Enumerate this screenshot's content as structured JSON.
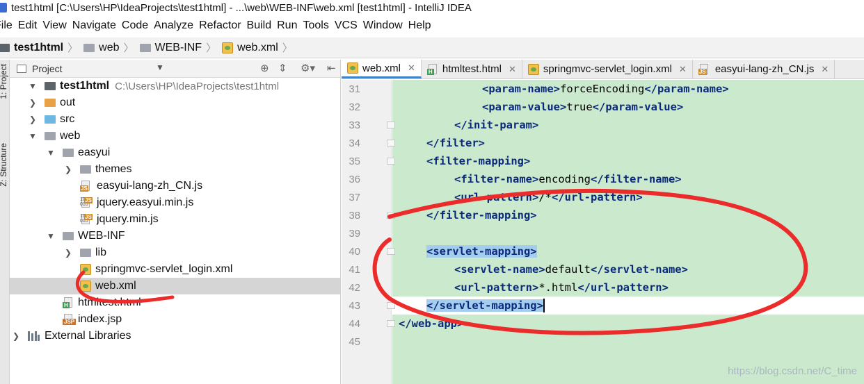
{
  "window": {
    "title": "test1html [C:\\Users\\HP\\IdeaProjects\\test1html] - ...\\web\\WEB-INF\\web.xml [test1html] - IntelliJ IDEA"
  },
  "menu": [
    "File",
    "Edit",
    "View",
    "Navigate",
    "Code",
    "Analyze",
    "Refactor",
    "Build",
    "Run",
    "Tools",
    "VCS",
    "Window",
    "Help"
  ],
  "breadcrumb": [
    "test1html",
    "web",
    "WEB-INF",
    "web.xml"
  ],
  "sidetabs": {
    "project": "1: Project",
    "structure": "Z: Structure"
  },
  "project_panel": {
    "title": "Project",
    "root": {
      "name": "test1html",
      "path": "C:\\Users\\HP\\IdeaProjects\\test1html"
    },
    "items": [
      {
        "label": "out"
      },
      {
        "label": "src"
      },
      {
        "label": "web"
      },
      {
        "label": "easyui"
      },
      {
        "label": "themes"
      },
      {
        "label": "easyui-lang-zh_CN.js"
      },
      {
        "label": "jquery.easyui.min.js"
      },
      {
        "label": "jquery.min.js"
      },
      {
        "label": "WEB-INF"
      },
      {
        "label": "lib"
      },
      {
        "label": "springmvc-servlet_login.xml"
      },
      {
        "label": "web.xml"
      },
      {
        "label": "htmltest.html"
      },
      {
        "label": "index.jsp"
      },
      {
        "label": "External Libraries"
      }
    ]
  },
  "editor_tabs": [
    {
      "label": "web.xml",
      "active": true
    },
    {
      "label": "htmltest.html"
    },
    {
      "label": "springmvc-servlet_login.xml"
    },
    {
      "label": "easyui-lang-zh_CN.js"
    }
  ],
  "code_lines": [
    {
      "num": "31",
      "open": "<param-name>",
      "text": "forceEncoding",
      "close": "</param-name>"
    },
    {
      "num": "32",
      "open": "<param-value>",
      "text": "true",
      "close": "</param-value>"
    },
    {
      "num": "33",
      "open": "</init-param>"
    },
    {
      "num": "34",
      "open": "</filter>"
    },
    {
      "num": "35",
      "open": "<filter-mapping>"
    },
    {
      "num": "36",
      "open": "<filter-name>",
      "text": "encoding",
      "close": "</filter-name>"
    },
    {
      "num": "37",
      "open": "<url-pattern>",
      "text": "/*",
      "close": "</url-pattern>"
    },
    {
      "num": "38",
      "open": "</filter-mapping>"
    },
    {
      "num": "39"
    },
    {
      "num": "40",
      "open": "<servlet-mapping>"
    },
    {
      "num": "41",
      "open": "<servlet-name>",
      "text": "default",
      "close": "</servlet-name>"
    },
    {
      "num": "42",
      "open": "<url-pattern>",
      "text": "*.html",
      "close": "</url-pattern>"
    },
    {
      "num": "43",
      "open": "</servlet-mapping>"
    },
    {
      "num": "44",
      "open": "</web-app>"
    },
    {
      "num": "45"
    }
  ],
  "watermark": "https://blog.csdn.net/C_time"
}
